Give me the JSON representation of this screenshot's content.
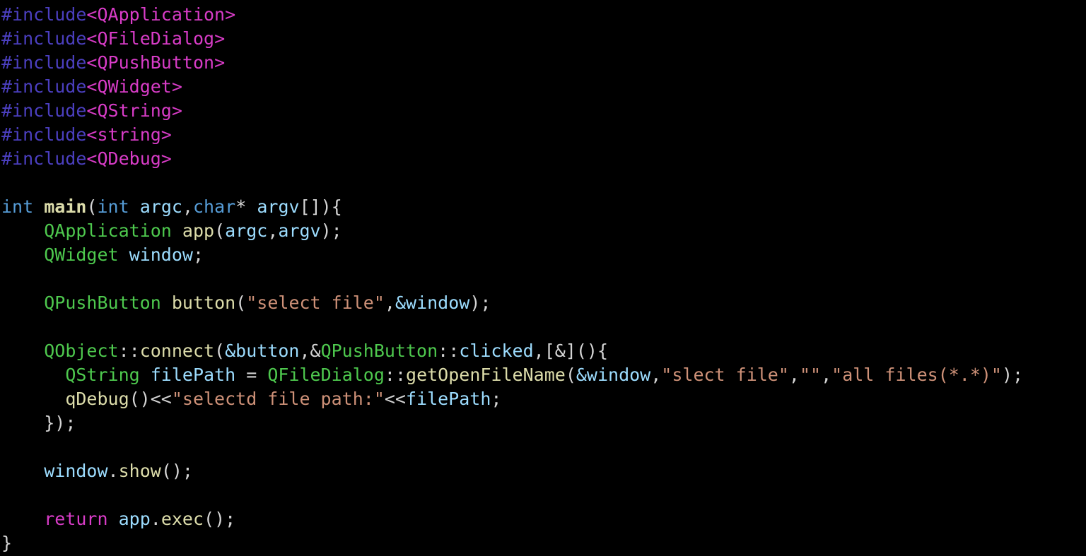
{
  "code": {
    "includes": [
      "QApplication",
      "QFileDialog",
      "QPushButton",
      "QWidget",
      "QString",
      "string",
      "QDebug"
    ],
    "returnType": "int",
    "mainName": "main",
    "paramIntType": "int",
    "paramArgc": "argc",
    "paramCharType": "char",
    "paramStar": "*",
    "paramArgv": "argv",
    "paramBrackets": "[]",
    "QApplication": "QApplication",
    "appVar": "app",
    "argcRef": "argc",
    "argvRef": "argv",
    "QWidget": "QWidget",
    "windowVar": "window",
    "QPushButton": "QPushButton",
    "buttonVar": "button",
    "buttonLabel": "\"select file\"",
    "windowAddr": "&window",
    "QObject": "QObject",
    "connect": "connect",
    "buttonAddr": "&button",
    "QPushButtonScope": "QPushButton",
    "clickedSig": "clicked",
    "lambdaCapture": "[&]",
    "QString": "QString",
    "filePathVar": "filePath",
    "QFileDialog": "QFileDialog",
    "getOpenFileName": "getOpenFileName",
    "dlgTitle": "\"slect file\"",
    "dlgDir": "\"\"",
    "dlgFilter": "\"all files(*.*)\"",
    "qDebugCall": "qDebug",
    "debugLabel": "\"selectd file path:\"",
    "filePathRef": "filePath",
    "showCall": "show",
    "returnKw": "return",
    "execCall": "exec"
  }
}
